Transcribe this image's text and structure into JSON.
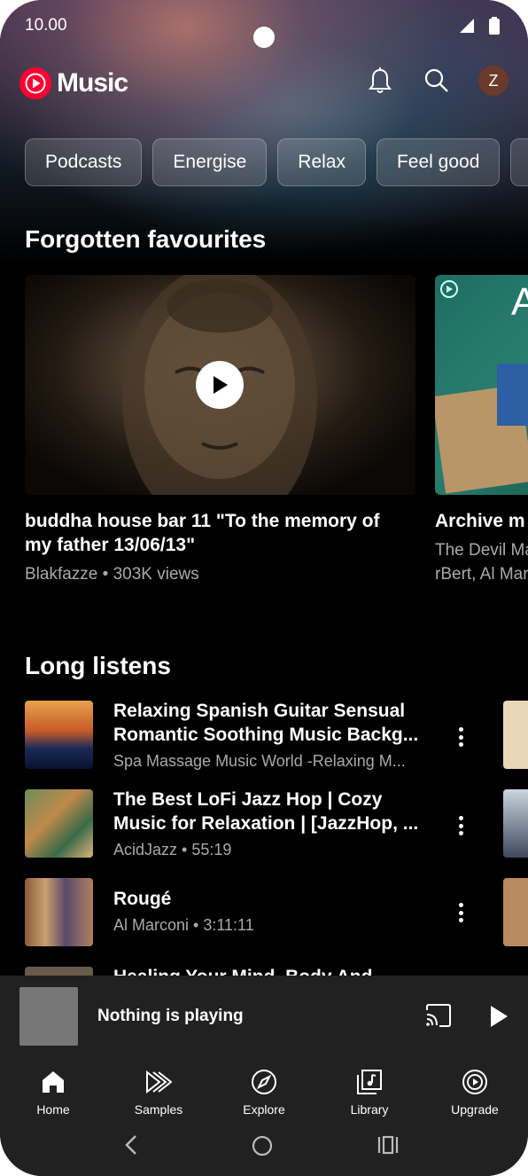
{
  "status": {
    "time": "10.00"
  },
  "header": {
    "logo_text": "Music",
    "avatar_letter": "Z"
  },
  "chips": [
    "Podcasts",
    "Energise",
    "Relax",
    "Feel good"
  ],
  "forgotten": {
    "title": "Forgotten favourites",
    "cards": [
      {
        "title_line1": "buddha house bar 11 \"To the memory of",
        "title_line2": "my father 13/06/13\"",
        "subtitle": "Blakfazze • 303K views"
      },
      {
        "title_line1": "Archive m",
        "sub_line1": "The Devil Ma",
        "sub_line2": "rBert, Al Mar"
      }
    ]
  },
  "long_listens": {
    "title": "Long listens",
    "items": [
      {
        "line1": "Relaxing Spanish Guitar Sensual",
        "line2": "Romantic Soothing Music Backg...",
        "subtitle": " Spa Massage Music World -Relaxing M..."
      },
      {
        "line1": "The Best LoFi Jazz Hop | Cozy",
        "line2": "Music for Relaxation | [JazzHop, ...",
        "subtitle": "AcidJazz • 55:19"
      },
      {
        "line1": "Rougé",
        "line2": "",
        "subtitle": "Al Marconi • 3:11:11"
      },
      {
        "line1": "Healing Your Mind, Body And",
        "line2": "",
        "subtitle": ""
      }
    ]
  },
  "player": {
    "text": "Nothing is playing"
  },
  "nav": {
    "tabs": [
      "Home",
      "Samples",
      "Explore",
      "Library",
      "Upgrade"
    ]
  },
  "colors": {
    "brand_red": "#ff0033",
    "panel": "#212121",
    "secondary_text": "#a9a9a9"
  }
}
